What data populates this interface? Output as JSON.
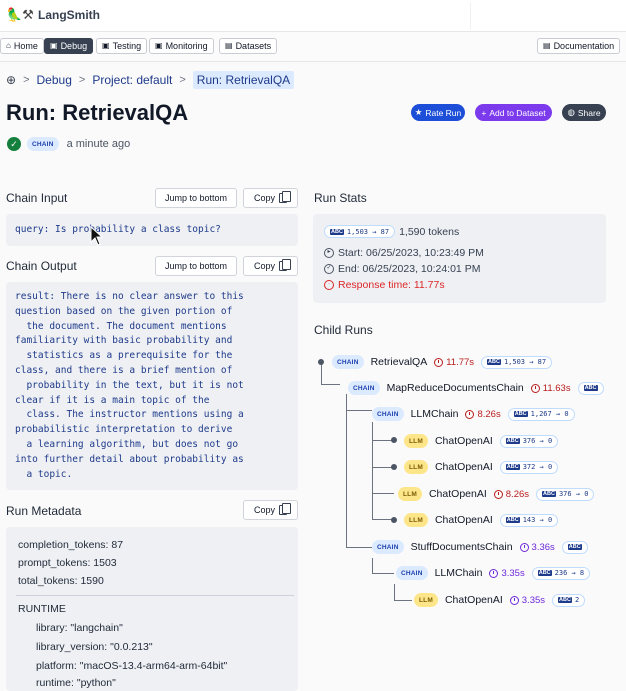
{
  "app": {
    "name": "LangSmith"
  },
  "nav": {
    "items": [
      {
        "label": "Home",
        "icon": "home-icon"
      },
      {
        "label": "Debug",
        "icon": "debug-icon",
        "active": true
      },
      {
        "label": "Testing",
        "icon": "testing-icon"
      },
      {
        "label": "Monitoring",
        "icon": "monitoring-icon"
      },
      {
        "label": "Datasets",
        "icon": "datasets-icon"
      }
    ],
    "documentation": "Documentation"
  },
  "breadcrumb": {
    "root": "Debug",
    "project": "Project: default",
    "current": "Run: RetrievalQA"
  },
  "run": {
    "title": "Run: RetrievalQA",
    "type_tag": "CHAIN",
    "time_ago": "a minute ago",
    "actions": {
      "rate": "Rate Run",
      "add_dataset": "Add to Dataset",
      "share": "Share"
    }
  },
  "chain_input": {
    "title": "Chain Input",
    "jump_label": "Jump to bottom",
    "copy_label": "Copy",
    "text": "query: Is probability a class topic?"
  },
  "chain_output": {
    "title": "Chain Output",
    "jump_label": "Jump to bottom",
    "copy_label": "Copy",
    "text": "result: There is no clear answer to this\nquestion based on the given portion of\n  the document. The document mentions\nfamiliarity with basic probability and\n  statistics as a prerequisite for the\nclass, and there is a brief mention of\n  probability in the text, but it is not\nclear if it is a main topic of the\n  class. The instructor mentions using a\nprobabilistic interpretation to derive\n  a learning algorithm, but does not go\ninto further detail about probability as\n  a topic."
  },
  "run_metadata": {
    "title": "Run Metadata",
    "copy_label": "Copy",
    "completion_tokens": "completion_tokens: 87",
    "prompt_tokens": "prompt_tokens: 1503",
    "total_tokens": "total_tokens: 1590",
    "runtime_header": "RUNTIME",
    "library": "library: \"langchain\"",
    "library_version": "library_version: \"0.0.213\"",
    "platform": "platform: \"macOS-13.4-arm64-arm-64bit\"",
    "runtime": "runtime: \"python\""
  },
  "run_stats": {
    "title": "Run Stats",
    "token_badge": "1,503 → 87",
    "tokens": "1,590 tokens",
    "start": "Start: 06/25/2023, 10:23:49 PM",
    "end": "End: 06/25/2023, 10:24:01 PM",
    "response_time": "Response time: 11.77s"
  },
  "child_runs": {
    "title": "Child Runs",
    "rows": [
      {
        "tag": "CHAIN",
        "name": "RetrievalQA",
        "latency": "11.77s",
        "tokens": "1,503 → 87"
      },
      {
        "tag": "CHAIN",
        "name": "MapReduceDocumentsChain",
        "latency": "11.63s",
        "tokens": ""
      },
      {
        "tag": "CHAIN",
        "name": "LLMChain",
        "latency": "8.26s",
        "tokens": "1,267 → 0"
      },
      {
        "tag": "LLM",
        "name": "ChatOpenAI",
        "latency": "",
        "tokens": "376 → 0"
      },
      {
        "tag": "LLM",
        "name": "ChatOpenAI",
        "latency": "",
        "tokens": "372 → 0"
      },
      {
        "tag": "LLM",
        "name": "ChatOpenAI",
        "latency": "8.26s",
        "tokens": "376 → 0"
      },
      {
        "tag": "LLM",
        "name": "ChatOpenAI",
        "latency": "",
        "tokens": "143 → 0"
      },
      {
        "tag": "CHAIN",
        "name": "StuffDocumentsChain",
        "latency": "3.36s",
        "tokens": ""
      },
      {
        "tag": "CHAIN",
        "name": "LLMChain",
        "latency": "3.35s",
        "tokens": "236 → 8"
      },
      {
        "tag": "LLM",
        "name": "ChatOpenAI",
        "latency": "3.35s",
        "tokens": "2"
      }
    ]
  },
  "icons": {
    "abc": "ABC"
  },
  "colors": {
    "accent": "#1d4ed8",
    "purple": "#7c3aed",
    "danger": "#dc2626",
    "success": "#15803d"
  }
}
